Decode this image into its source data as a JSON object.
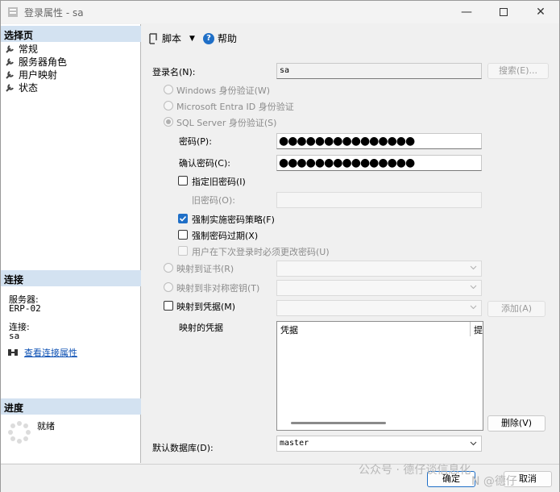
{
  "window": {
    "title": "登录属性 - sa"
  },
  "left": {
    "select_page_header": "选择页",
    "pages": [
      "常规",
      "服务器角色",
      "用户映射",
      "状态"
    ],
    "connection_header": "连接",
    "server_label": "服务器:",
    "server_value": "ERP-02",
    "connection_label": "连接:",
    "connection_value": "sa",
    "view_connection_link": "查看连接属性",
    "progress_header": "进度",
    "progress_status": "就绪"
  },
  "toolbar": {
    "script_label": "脚本",
    "help_label": "帮助"
  },
  "form": {
    "login_name_label": "登录名(N):",
    "login_name_value": "sa",
    "search_button": "搜索(E)...",
    "auth_windows": "Windows 身份验证(W)",
    "auth_entra": "Microsoft Entra ID 身份验证",
    "auth_sql": "SQL Server 身份验证(S)",
    "password_label": "密码(P):",
    "password_value": "●●●●●●●●●●●●●●●",
    "confirm_password_label": "确认密码(C):",
    "confirm_password_value": "●●●●●●●●●●●●●●●",
    "specify_old_password": "指定旧密码(I)",
    "old_password_label": "旧密码(O):",
    "enforce_policy": "强制实施密码策略(F)",
    "enforce_expiration": "强制密码过期(X)",
    "must_change": "用户在下次登录时必须更改密码(U)",
    "map_certificate": "映射到证书(R)",
    "map_asym_key": "映射到非对称密钥(T)",
    "map_credential": "映射到凭据(M)",
    "add_button": "添加(A)",
    "mapped_credentials_label": "映射的凭据",
    "grid_col_credential": "凭据",
    "grid_col_provider": "提",
    "delete_button": "删除(V)",
    "default_db_label": "默认数据库(D):",
    "default_db_value": "master"
  },
  "footer": {
    "ok_button": "确定",
    "cancel_button": "取消"
  },
  "watermark": {
    "text1": "公众号 · 德仔谈信息化",
    "text2": "N @德仔"
  }
}
